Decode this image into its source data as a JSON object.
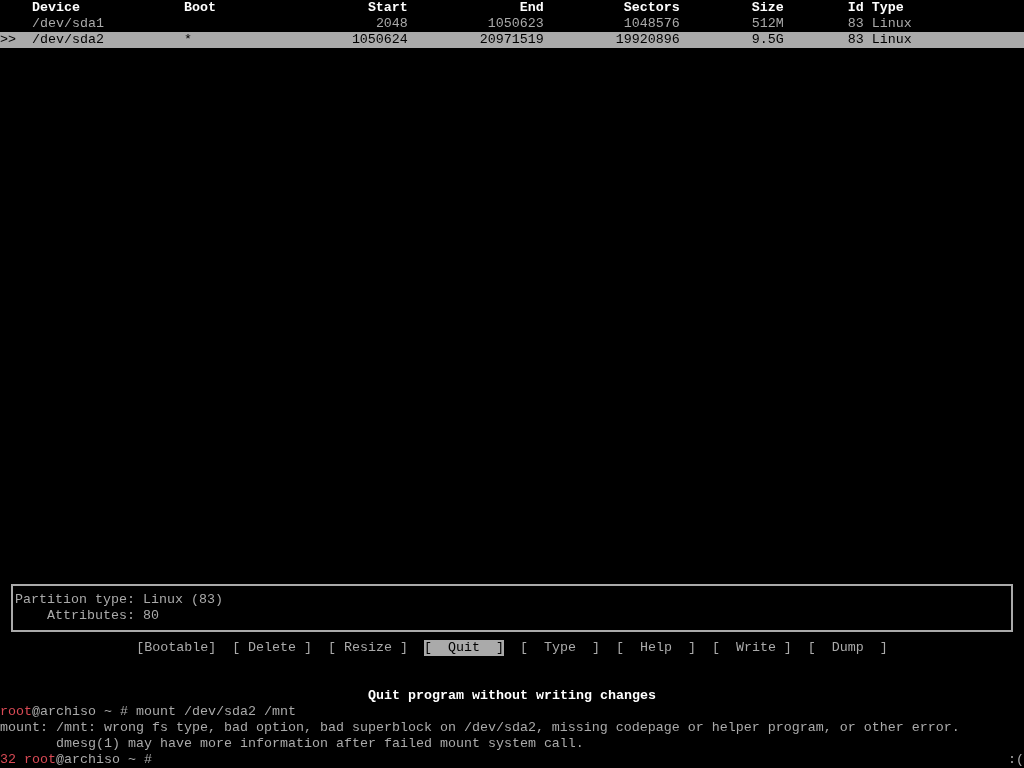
{
  "table": {
    "cursor": ">>",
    "columns": [
      "Device",
      "Boot",
      "Start",
      "End",
      "Sectors",
      "Size",
      "Id",
      "Type"
    ],
    "rows": [
      {
        "selected": false,
        "cells": [
          "/dev/sda1",
          "",
          "2048",
          "1050623",
          "1048576",
          "512M",
          "83",
          "Linux"
        ]
      },
      {
        "selected": true,
        "cells": [
          "/dev/sda2",
          "*",
          "1050624",
          "20971519",
          "19920896",
          "9.5G",
          "83",
          "Linux"
        ]
      }
    ]
  },
  "info_panel": [
    {
      "label": "Partition type:",
      "value": "Linux (83)"
    },
    {
      "label": "Attributes:",
      "value": "80"
    }
  ],
  "buttons": [
    {
      "label": "[Bootable]",
      "selected": false
    },
    {
      "label": "[ Delete ]",
      "selected": false
    },
    {
      "label": "[ Resize ]",
      "selected": false
    },
    {
      "label": "[  Quit  ]",
      "selected": true
    },
    {
      "label": "[  Type  ]",
      "selected": false
    },
    {
      "label": "[  Help  ]",
      "selected": false
    },
    {
      "label": "[  Write ]",
      "selected": false
    },
    {
      "label": "[  Dump  ]",
      "selected": false
    }
  ],
  "hint": "Quit program without writing changes",
  "shell": [
    {
      "kind": "prompt",
      "user": "root",
      "host": "@archiso",
      "path": "~",
      "symbol": "#",
      "command": "mount /dev/sda2 /mnt"
    },
    {
      "kind": "output",
      "text": "mount: /mnt: wrong fs type, bad option, bad superblock on /dev/sda2, missing codepage or helper program, or other error."
    },
    {
      "kind": "output",
      "text": "       dmesg(1) may have more information after failed mount system call."
    },
    {
      "kind": "prompt",
      "exit_code": "32",
      "user": "root",
      "host": "@archiso",
      "path": "~",
      "symbol": "#",
      "right_prompt": ":("
    }
  ]
}
